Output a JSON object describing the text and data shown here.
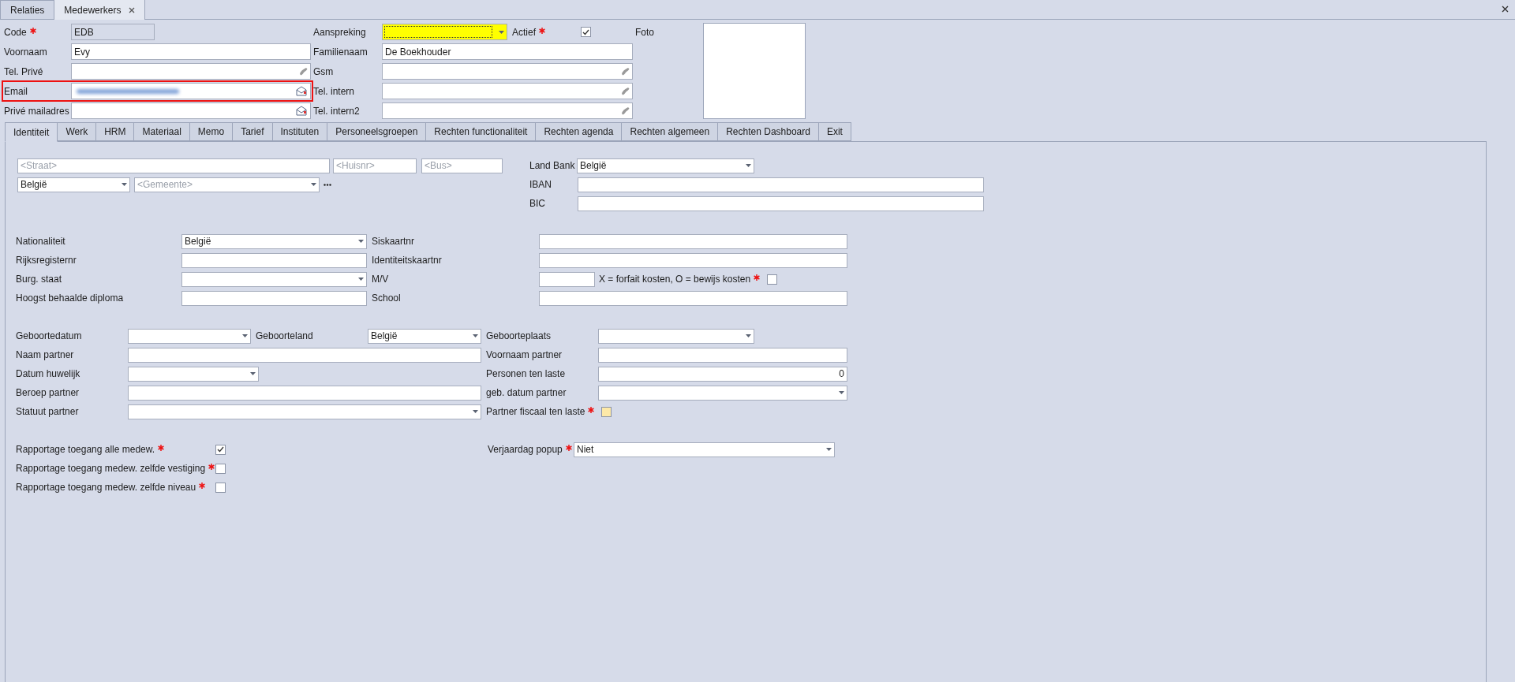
{
  "doc_tabs": [
    {
      "label": "Relaties",
      "selected": false,
      "closable": false
    },
    {
      "label": "Medewerkers",
      "selected": true,
      "closable": true
    }
  ],
  "header": {
    "rows": [
      {
        "fields": [
          {
            "label": "Code",
            "required": true,
            "kind": "readonly",
            "value": "EDB"
          },
          {
            "label": "Aanspreking",
            "kind": "select",
            "focused": true
          },
          {
            "label": "Actief",
            "required": true,
            "kind": "checkbox",
            "checked": true
          }
        ]
      },
      {
        "fields": [
          {
            "label": "Voornaam",
            "kind": "text",
            "value": "Evy"
          },
          {
            "label": "Familienaam",
            "kind": "text",
            "value": "De Boekhouder"
          }
        ]
      },
      {
        "fields": [
          {
            "label": "Tel. Privé",
            "kind": "phone"
          },
          {
            "label": "Gsm",
            "kind": "phone"
          }
        ]
      },
      {
        "fields": [
          {
            "label": "Email",
            "kind": "mail",
            "redacted": true,
            "highlighted": true
          },
          {
            "label": "Tel. intern",
            "kind": "phone"
          }
        ]
      },
      {
        "fields": [
          {
            "label": "Privé mailadres",
            "kind": "mail"
          },
          {
            "label": "Tel. intern2",
            "kind": "phone"
          }
        ]
      }
    ],
    "photo": {
      "label": "Foto"
    }
  },
  "tabs": [
    {
      "label": "Identiteit",
      "selected": true
    },
    {
      "label": "Werk",
      "selected": false
    },
    {
      "label": "HRM",
      "selected": false
    },
    {
      "label": "Materiaal",
      "selected": false
    },
    {
      "label": "Memo",
      "selected": false
    },
    {
      "label": "Tarief",
      "selected": false
    },
    {
      "label": "Instituten",
      "selected": false
    },
    {
      "label": "Personeelsgroepen",
      "selected": false
    },
    {
      "label": "Rechten functionaliteit",
      "selected": false
    },
    {
      "label": "Rechten agenda",
      "selected": false
    },
    {
      "label": "Rechten algemeen",
      "selected": false
    },
    {
      "label": "Rechten Dashboard",
      "selected": false
    },
    {
      "label": "Exit",
      "selected": false
    }
  ],
  "sections": [
    {
      "rows": [
        {
          "fields": [
            {
              "kind": "text",
              "placeholder": "<Straat>"
            },
            {
              "kind": "text",
              "placeholder": "<Huisnr>"
            },
            {
              "kind": "text",
              "placeholder": "<Bus>"
            },
            {
              "label": "Land Bank",
              "kind": "select",
              "value": "België"
            }
          ]
        },
        {
          "fields": [
            {
              "kind": "select",
              "value": "België"
            },
            {
              "kind": "select",
              "placeholder": "<Gemeente>",
              "more": true
            },
            {
              "label": "IBAN",
              "kind": "text"
            }
          ]
        },
        {
          "fields": [
            {
              "label": "BIC",
              "kind": "text"
            }
          ]
        }
      ]
    },
    {
      "rows": [
        {
          "fields": [
            {
              "label": "Nationaliteit",
              "kind": "select",
              "value": "België"
            },
            {
              "label": "Siskaartnr",
              "kind": "text"
            }
          ]
        },
        {
          "fields": [
            {
              "label": "Rijksregisternr",
              "kind": "text"
            },
            {
              "label": "Identiteitskaartnr",
              "kind": "text"
            }
          ]
        },
        {
          "fields": [
            {
              "label": "Burg. staat",
              "kind": "select"
            },
            {
              "label": "M/V",
              "kind": "text"
            },
            {
              "label": "X = forfait kosten, O = bewijs kosten",
              "required": true,
              "kind": "checkbox",
              "checked": false
            }
          ]
        },
        {
          "fields": [
            {
              "label": "Hoogst behaalde diploma",
              "kind": "text"
            },
            {
              "label": "School",
              "kind": "text"
            }
          ]
        }
      ]
    },
    {
      "rows": [
        {
          "fields": [
            {
              "label": "Geboortedatum",
              "kind": "select"
            },
            {
              "label": "Geboorteland",
              "kind": "select",
              "value": "België"
            },
            {
              "label": "Geboorteplaats",
              "kind": "select"
            }
          ]
        },
        {
          "fields": [
            {
              "label": "Naam partner",
              "kind": "text"
            },
            {
              "label": "Voornaam partner",
              "kind": "text"
            }
          ]
        },
        {
          "fields": [
            {
              "label": "Datum huwelijk",
              "kind": "select"
            },
            {
              "label": "Personen ten laste",
              "kind": "number",
              "value": "0"
            }
          ]
        },
        {
          "fields": [
            {
              "label": "Beroep partner",
              "kind": "text"
            },
            {
              "label": "geb. datum partner",
              "kind": "select"
            }
          ]
        },
        {
          "fields": [
            {
              "label": "Statuut partner",
              "kind": "select"
            },
            {
              "label": "Partner fiscaal ten laste",
              "required": true,
              "kind": "checkbox",
              "checked": false,
              "highlighted": true
            }
          ]
        }
      ]
    },
    {
      "rows": [
        {
          "fields": [
            {
              "label": "Rapportage toegang alle medew.",
              "required": true,
              "kind": "checkbox",
              "checked": true
            },
            {
              "label": "Verjaardag popup",
              "required": true,
              "kind": "select",
              "value": "Niet"
            }
          ]
        },
        {
          "fields": [
            {
              "label": "Rapportage toegang medew. zelfde vestiging",
              "required": true,
              "kind": "checkbox",
              "checked": false
            }
          ]
        },
        {
          "fields": [
            {
              "label": "Rapportage toegang medew. zelfde niveau",
              "required": true,
              "kind": "checkbox",
              "checked": false
            }
          ]
        }
      ]
    }
  ]
}
